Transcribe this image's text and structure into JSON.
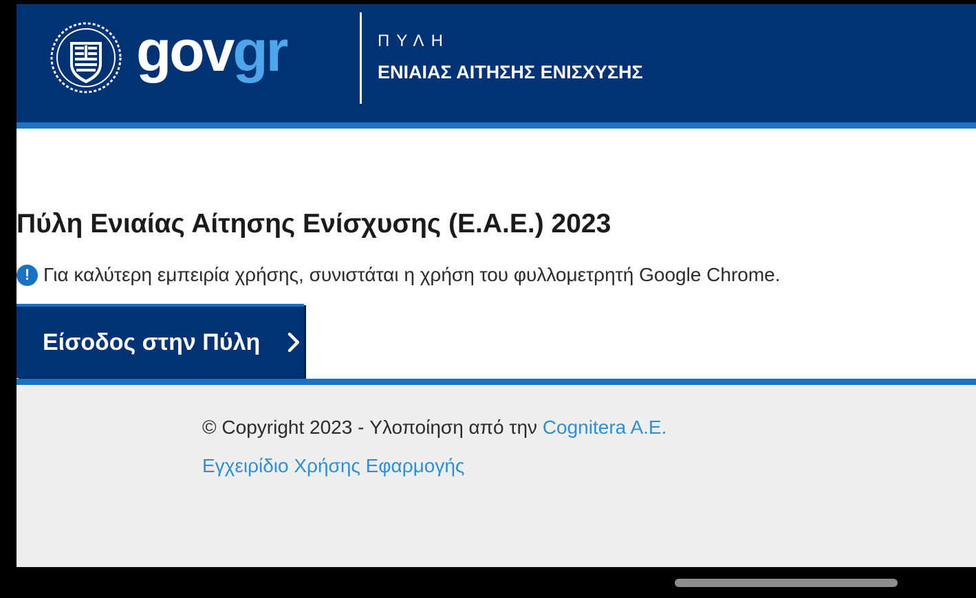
{
  "header": {
    "logo": {
      "part1": "gov",
      "part2": "gr"
    },
    "portal_label": "ΠΥΛΗ",
    "portal_title": "ΕΝΙΑΙΑΣ ΑΙΤΗΣΗΣ ΕΝΙΣΧΥΣΗΣ",
    "emblem_icon": "greek-coat-of-arms-icon"
  },
  "main": {
    "title": "Πύλη Ενιαίας Αίτησης Ενίσχυσης (Ε.Α.Ε.) 2023",
    "notice_icon": "exclamation-icon",
    "notice_icon_glyph": "!",
    "notice_text": "Για καλύτερη εμπειρία χρήσης, συνιστάται η χρήση του φυλλομετρητή Google Chrome.",
    "enter_button_label": "Είσοδος στην Πύλη",
    "enter_button_icon": "chevron-right-icon"
  },
  "footer": {
    "copyright_text": "© Copyright 2023 - Υλοποίηση από την ",
    "company_link": "Cognitera A.E.",
    "manual_link": "Εγχειρίδιο Χρήσης Εφαρμογής"
  },
  "colors": {
    "header_bg": "#003375",
    "accent_blue": "#1a72c4",
    "logo_gr": "#4da6ea",
    "link": "#2d8fd6",
    "footer_bg": "#eeeeee"
  }
}
